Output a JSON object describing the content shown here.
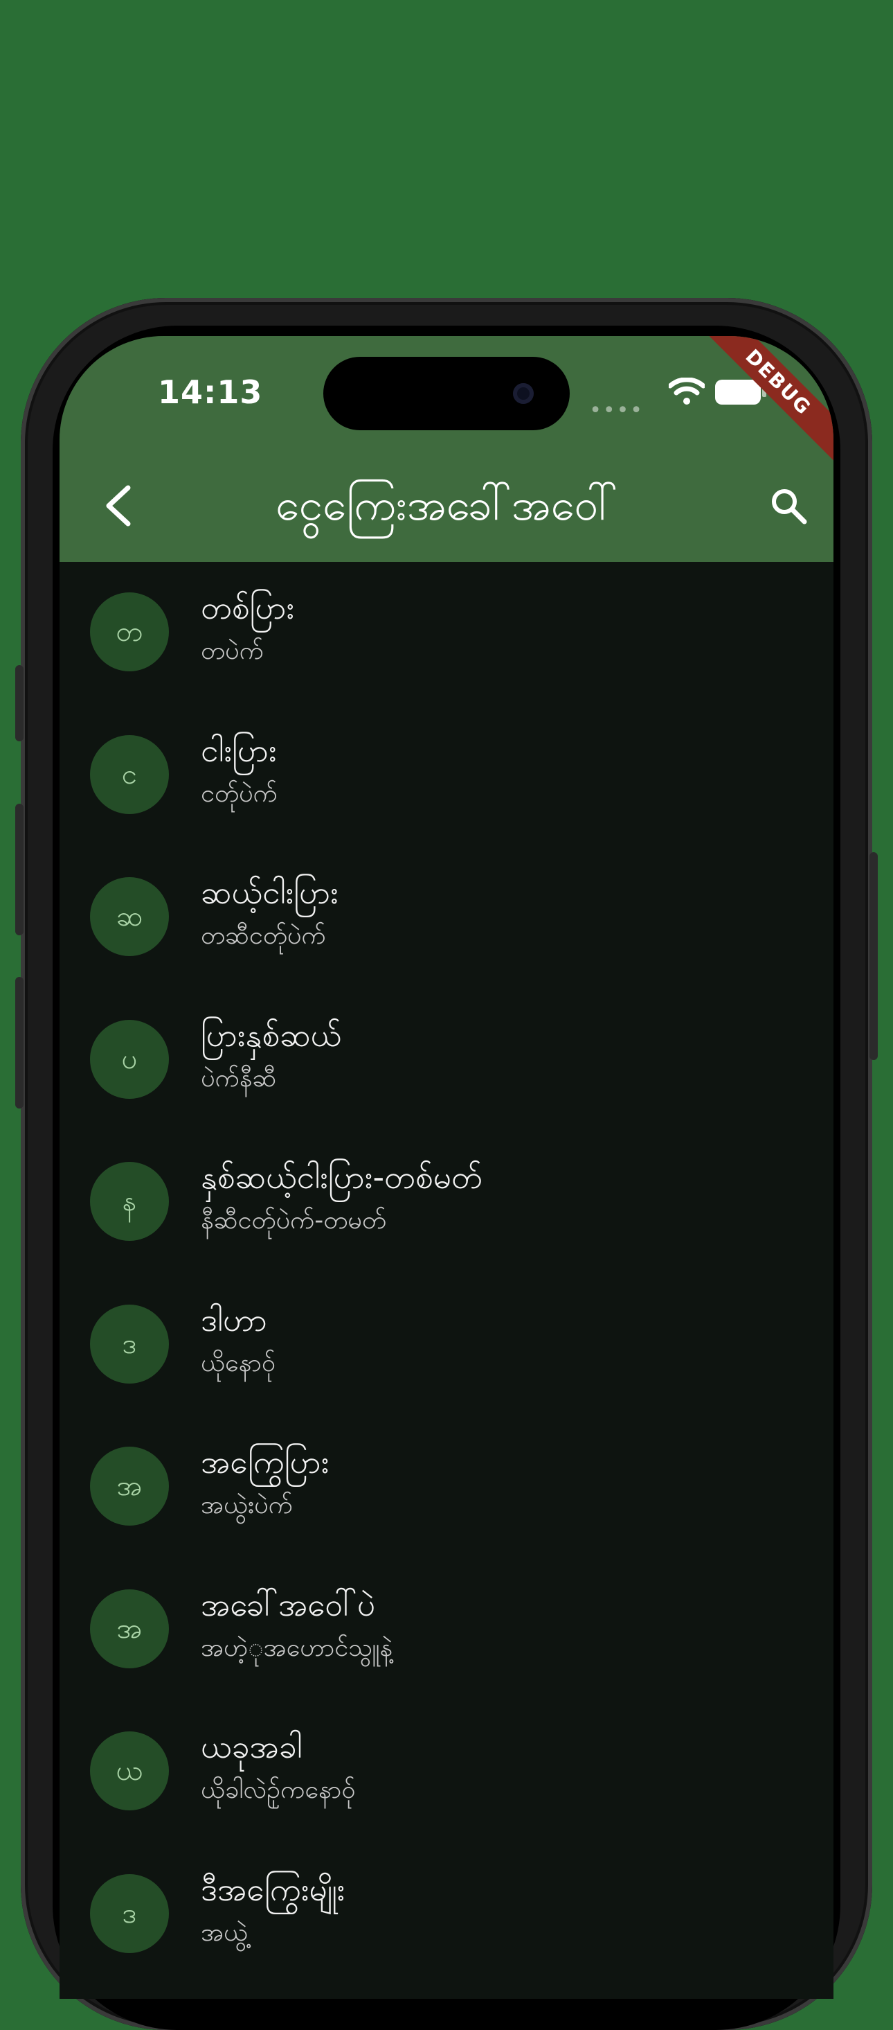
{
  "status": {
    "time": "14:13"
  },
  "debug_banner": "DEBUG",
  "appbar": {
    "title": "ငွေကြေးအခေါ်အဝေါ်"
  },
  "icons": {
    "back": "back-arrow-icon",
    "search": "search-icon",
    "wifi": "wifi-icon",
    "battery": "battery-icon"
  },
  "colors": {
    "background": "#2a6e35",
    "appbar": "#3f6b3e",
    "avatar": "#244d27",
    "list_bg": "#0e1410"
  },
  "items": [
    {
      "avatar": "တ",
      "title": "တစ်ပြား",
      "subtitle": "တပဲက်"
    },
    {
      "avatar": "င",
      "title": "ငါးပြား",
      "subtitle": "ငတ်ုပဲက်"
    },
    {
      "avatar": "ဆ",
      "title": "ဆယ့်ငါးပြား",
      "subtitle": "တဆီငတ်ုပဲက်"
    },
    {
      "avatar": "ပ",
      "title": "ပြားနှစ်ဆယ်",
      "subtitle": "ပဲက်နီဆီ"
    },
    {
      "avatar": "န",
      "title": "နှစ်ဆယ့်ငါးပြား-တစ်မတ်",
      "subtitle": "နီဆီငတ်ုပဲက်-တမတ်"
    },
    {
      "avatar": "ဒ",
      "title": "ဒါဟာ",
      "subtitle": "ယိုနောဝ်ု"
    },
    {
      "avatar": "အ",
      "title": "အကြွေပြား",
      "subtitle": "အယွဲးပဲက်"
    },
    {
      "avatar": "အ",
      "title": "အခေါ်အဝေါ်ပဲ",
      "subtitle": "အဟဲ့ုအဟောင်သွူနဲ့"
    },
    {
      "avatar": "ယ",
      "title": "ယခုအခါ",
      "subtitle": "ယိုခါလဲဉ်ုကနောဝ်ု"
    },
    {
      "avatar": "ဒ",
      "title": "ဒီအကြွေးမျိုး",
      "subtitle": "အယွဲ့"
    }
  ]
}
